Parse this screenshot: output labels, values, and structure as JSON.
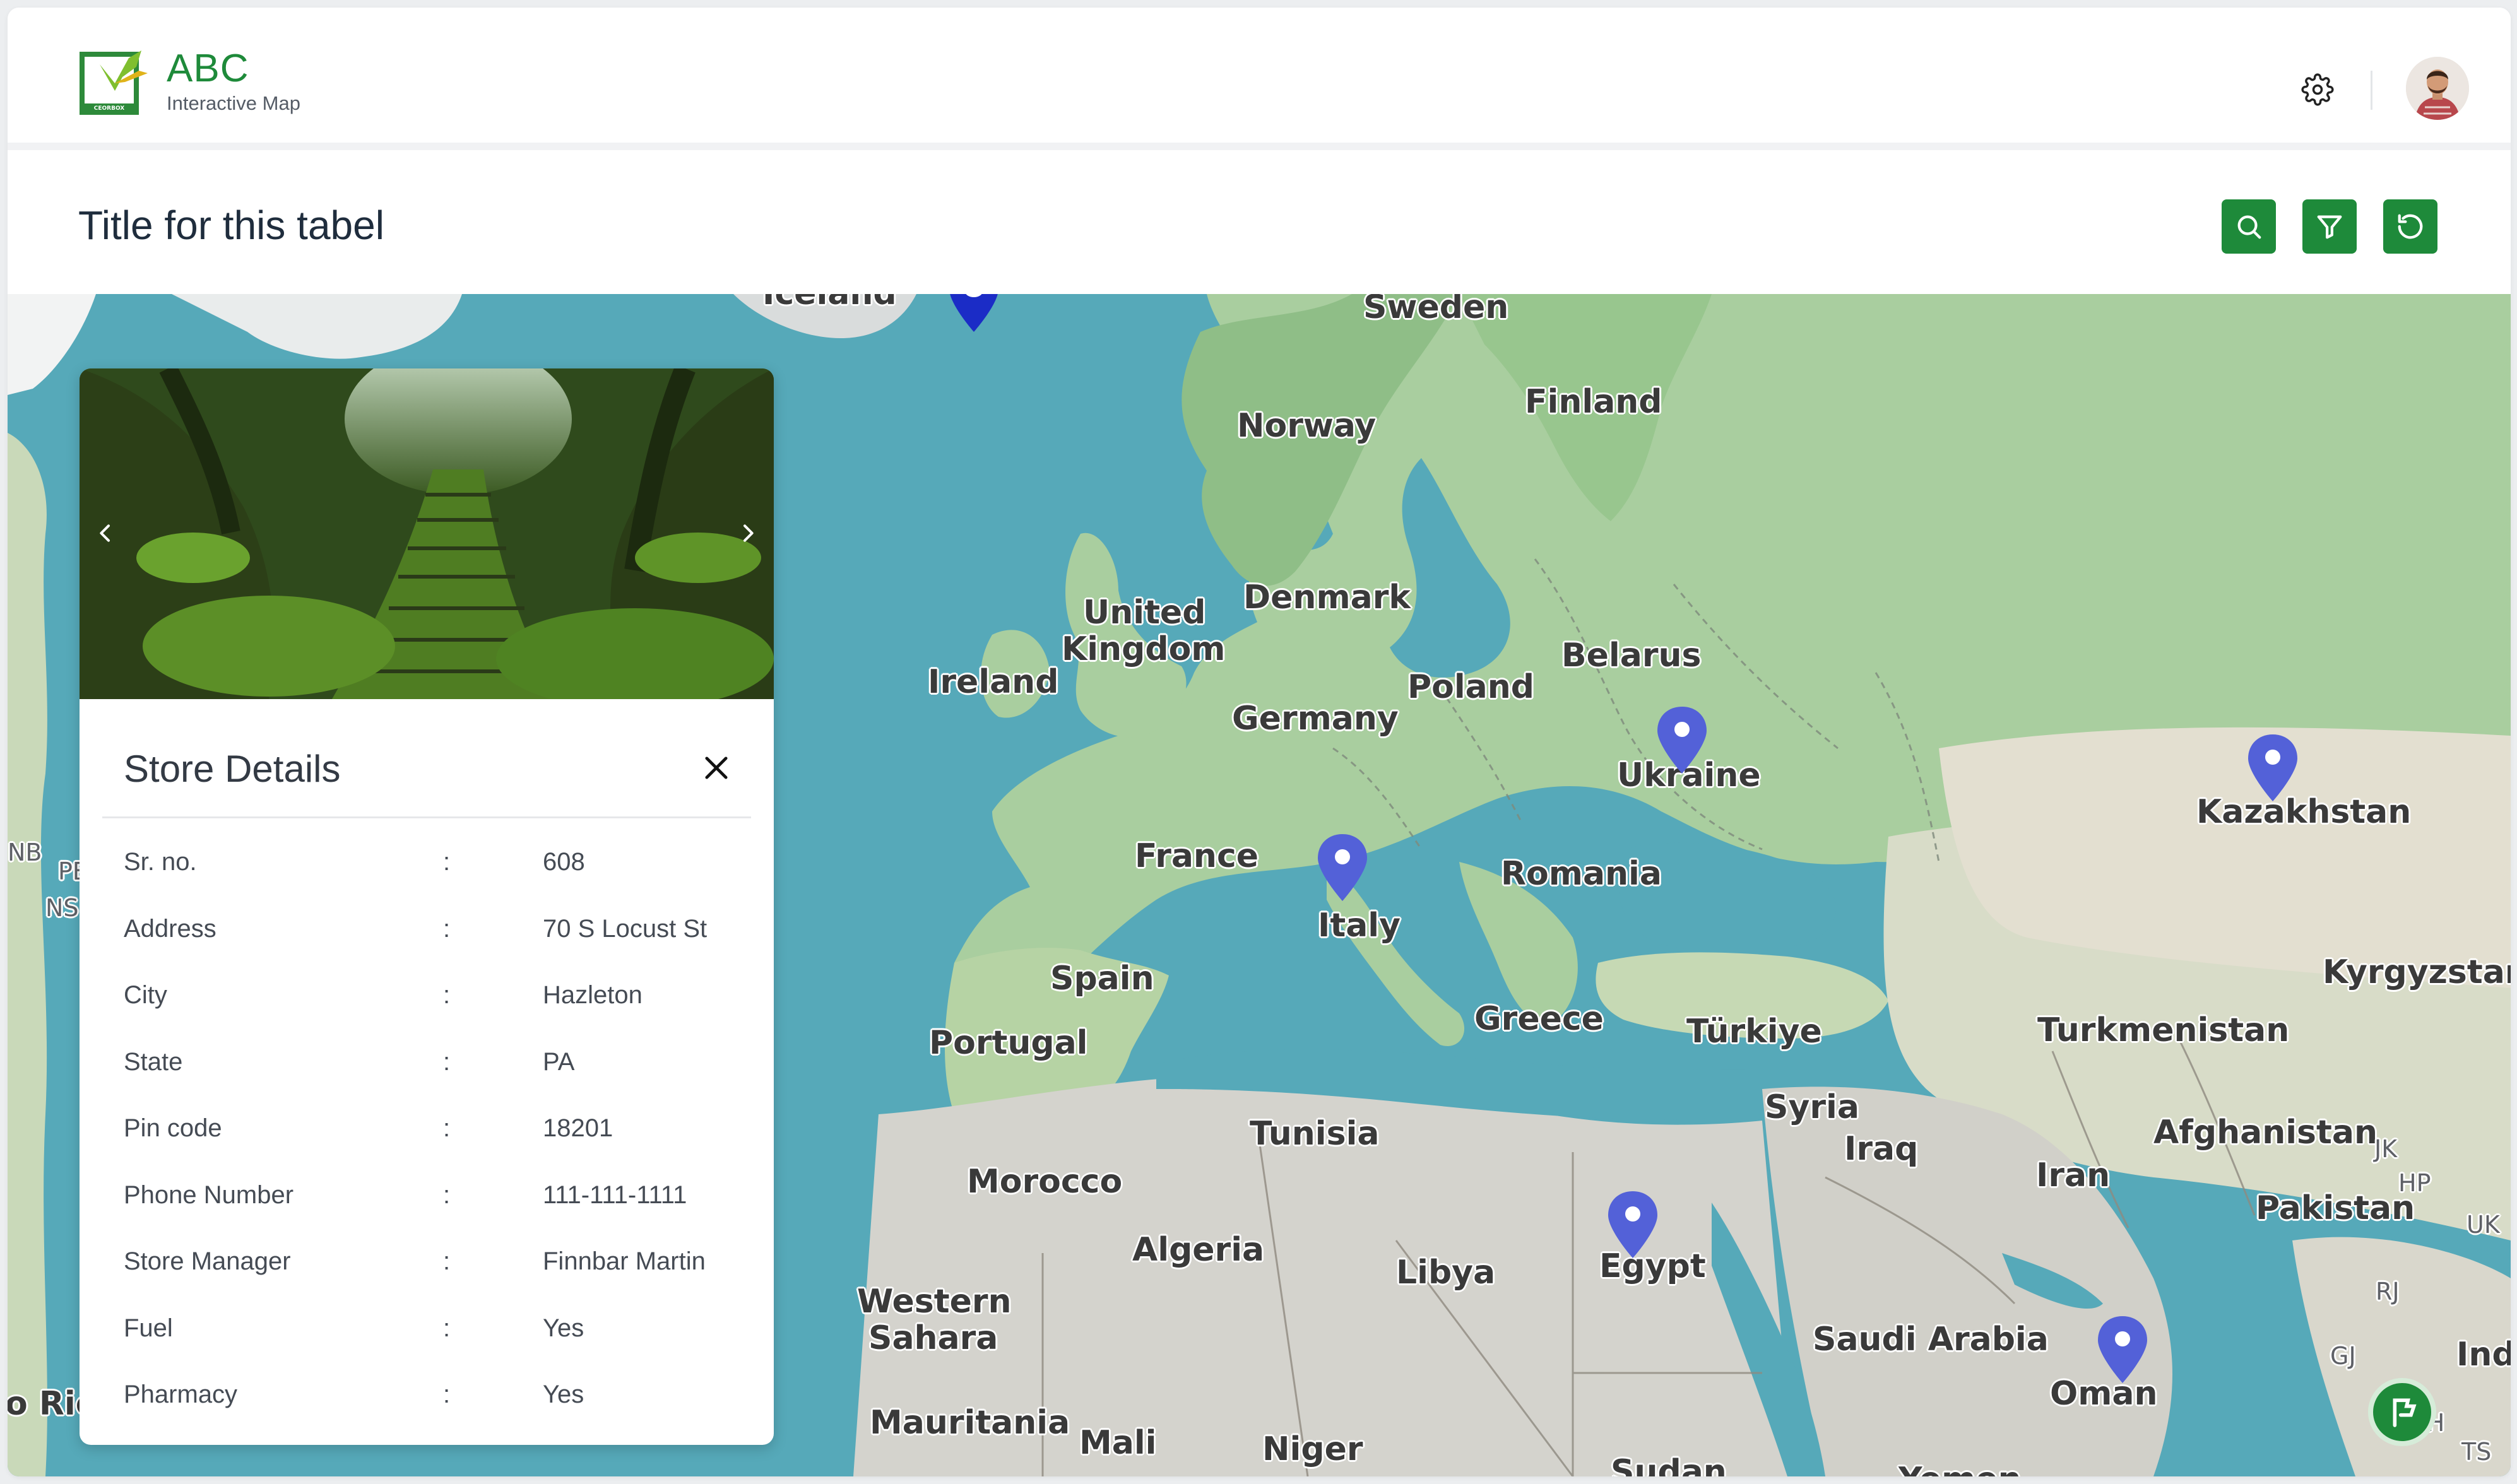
{
  "header": {
    "logo_title": "ABC",
    "logo_subtitle": "Interactive Map",
    "logo_badge": "CEORBOX"
  },
  "toolbar": {
    "title": "Title for this tabel",
    "buttons": [
      "search-icon",
      "filter-icon",
      "refresh-icon"
    ]
  },
  "colors": {
    "brand": "#1e8a3a",
    "water": "#56a9b9",
    "pin": "#5361d8"
  },
  "map": {
    "labels": [
      "Sweden",
      "Finland",
      "Norway",
      "Denmark",
      "United",
      "Kingdom",
      "Ireland",
      "Belarus",
      "Poland",
      "Germany",
      "Ukraine",
      "Kazakhstan",
      "France",
      "Romania",
      "Italy",
      "Kyrgyzstan",
      "Spain",
      "Greece",
      "Türkiye",
      "Turkmenistan",
      "Portugal",
      "Syria",
      "Tunisia",
      "Iraq",
      "Afghanistan",
      "Iran",
      "Morocco",
      "Pakistan",
      "Algeria",
      "Libya",
      "Egypt",
      "Western",
      "Sahara",
      "Saudi Arabia",
      "Oman",
      "Mauritania",
      "Mali",
      "Niger",
      "Sudan",
      "Yemen",
      "Iceland",
      "Indi",
      "o Ric"
    ],
    "minor_labels": [
      "NB",
      "PE",
      "NS",
      "JK",
      "HP",
      "UK",
      "RJ",
      "GJ",
      "TS",
      "MH"
    ],
    "markers": [
      "Italy",
      "Ukraine",
      "Kazakhstan",
      "Egypt",
      "Oman"
    ]
  },
  "store": {
    "heading": "Store Details",
    "separator": ":",
    "fields": [
      {
        "label": "Sr. no.",
        "value": "608"
      },
      {
        "label": "Address",
        "value": "70 S Locust St"
      },
      {
        "label": "City",
        "value": "Hazleton"
      },
      {
        "label": "State",
        "value": "PA"
      },
      {
        "label": "Pin code",
        "value": "18201"
      },
      {
        "label": "Phone Number",
        "value": "111-111-1111"
      },
      {
        "label": "Store Manager",
        "value": "Finnbar Martin"
      },
      {
        "label": "Fuel",
        "value": "Yes"
      },
      {
        "label": "Pharmacy",
        "value": "Yes"
      }
    ]
  }
}
